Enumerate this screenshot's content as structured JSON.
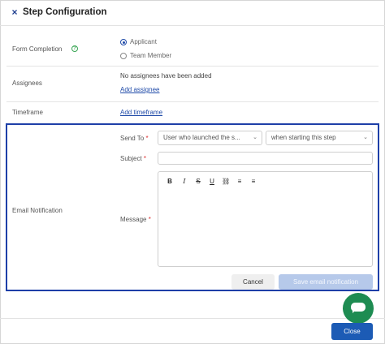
{
  "header": {
    "close_icon": "×",
    "title": "Step Configuration"
  },
  "form_completion": {
    "label": "Form Completion",
    "help_icon": "?",
    "options": [
      {
        "label": "Applicant",
        "selected": true
      },
      {
        "label": "Team Member",
        "selected": false
      }
    ]
  },
  "assignees": {
    "label": "Assignees",
    "empty_text": "No assignees have been added",
    "add_link": "Add assignee"
  },
  "timeframe": {
    "label": "Timeframe",
    "add_link": "Add timeframe"
  },
  "email": {
    "section_label": "Email Notification",
    "send_to_label": "Send To",
    "required_mark": "*",
    "recipient_select": "User who launched the s...",
    "timing_select": "when starting this step",
    "subject_label": "Subject",
    "subject_value": "",
    "message_label": "Message",
    "toolbar": {
      "bold": "B",
      "italic": "I",
      "strike": "S",
      "underline": "U",
      "link": "⛓",
      "ordered_list": "≡",
      "bullet_list": "≡"
    },
    "cancel_label": "Cancel",
    "save_label": "Save email notification"
  },
  "footer": {
    "close_label": "Close"
  },
  "colors": {
    "accent": "#1c5bb5",
    "highlight_border": "#1e3fa8",
    "chat": "#1e8c52",
    "save_disabled": "#b6c9ea"
  }
}
